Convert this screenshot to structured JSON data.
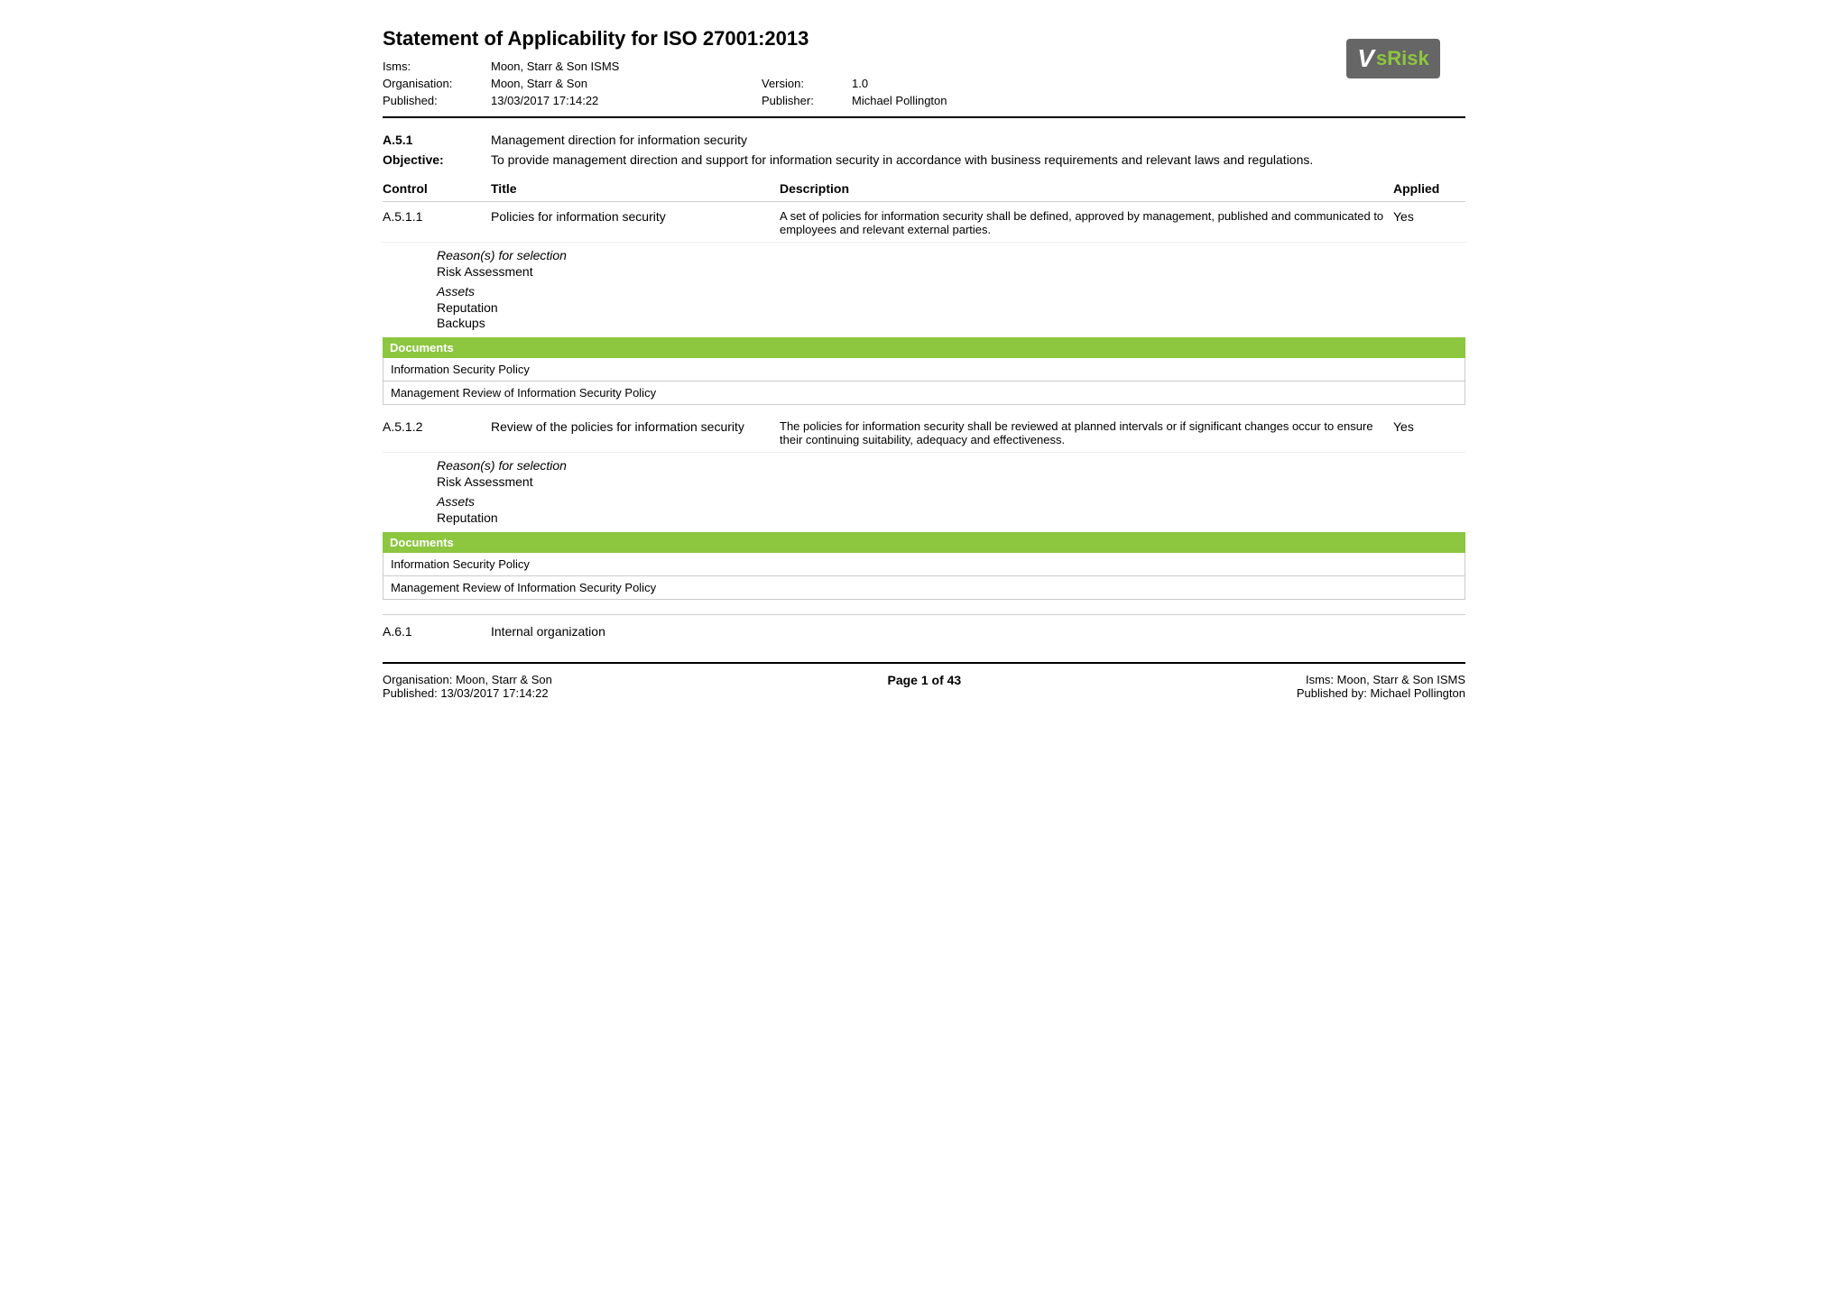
{
  "page": {
    "title": "Statement of Applicability for ISO 27001:2013",
    "header": {
      "isms_label": "Isms:",
      "isms_value": "Moon, Starr & Son ISMS",
      "org_label": "Organisation:",
      "org_value": "Moon, Starr & Son",
      "published_label": "Published:",
      "published_value": "13/03/2017 17:14:22",
      "version_label": "Version:",
      "version_value": "1.0",
      "publisher_label": "Publisher:",
      "publisher_value": "Michael Pollington"
    },
    "logo": {
      "v": "V",
      "srisk": "sRisk"
    },
    "section_a51": {
      "number": "A.5.1",
      "title": "Management direction for information security",
      "objective_label": "Objective:",
      "objective_text": "To provide management direction and support for information security in accordance with business requirements and relevant laws and regulations.",
      "table_headers": {
        "control": "Control",
        "title": "Title",
        "description": "Description",
        "applied": "Applied"
      },
      "controls": [
        {
          "number": "A.5.1.1",
          "title": "Policies for information security",
          "description": "A set of policies for information security shall be defined, approved by management, published and communicated to employees and relevant external parties.",
          "applied": "Yes",
          "reasons_label": "Reason(s) for selection",
          "reasons": [
            "Risk Assessment"
          ],
          "assets_label": "Assets",
          "assets": [
            "Reputation",
            "Backups"
          ],
          "documents_label": "Documents",
          "documents": [
            "Information Security Policy",
            "Management Review of Information Security Policy"
          ]
        },
        {
          "number": "A.5.1.2",
          "title": "Review of the policies for information security",
          "description": "The policies for information security shall be reviewed at planned intervals or if significant changes occur to ensure their continuing suitability, adequacy and effectiveness.",
          "applied": "Yes",
          "reasons_label": "Reason(s) for selection",
          "reasons": [
            "Risk Assessment"
          ],
          "assets_label": "Assets",
          "assets": [
            "Reputation"
          ],
          "documents_label": "Documents",
          "documents": [
            "Information Security Policy",
            "Management Review of Information Security Policy"
          ]
        }
      ]
    },
    "section_a61": {
      "number": "A.6.1",
      "title": "Internal organization"
    },
    "footer": {
      "org_label": "Organisation:",
      "org_value": "Moon, Starr & Son",
      "isms_label": "Isms:",
      "isms_value": "Moon, Starr & Son ISMS",
      "published_label": "Published:",
      "published_value": "13/03/2017 17:14:22",
      "published_by_label": "Published by:",
      "published_by_value": "Michael Pollington",
      "page_text": "Page 1 of 43"
    }
  }
}
